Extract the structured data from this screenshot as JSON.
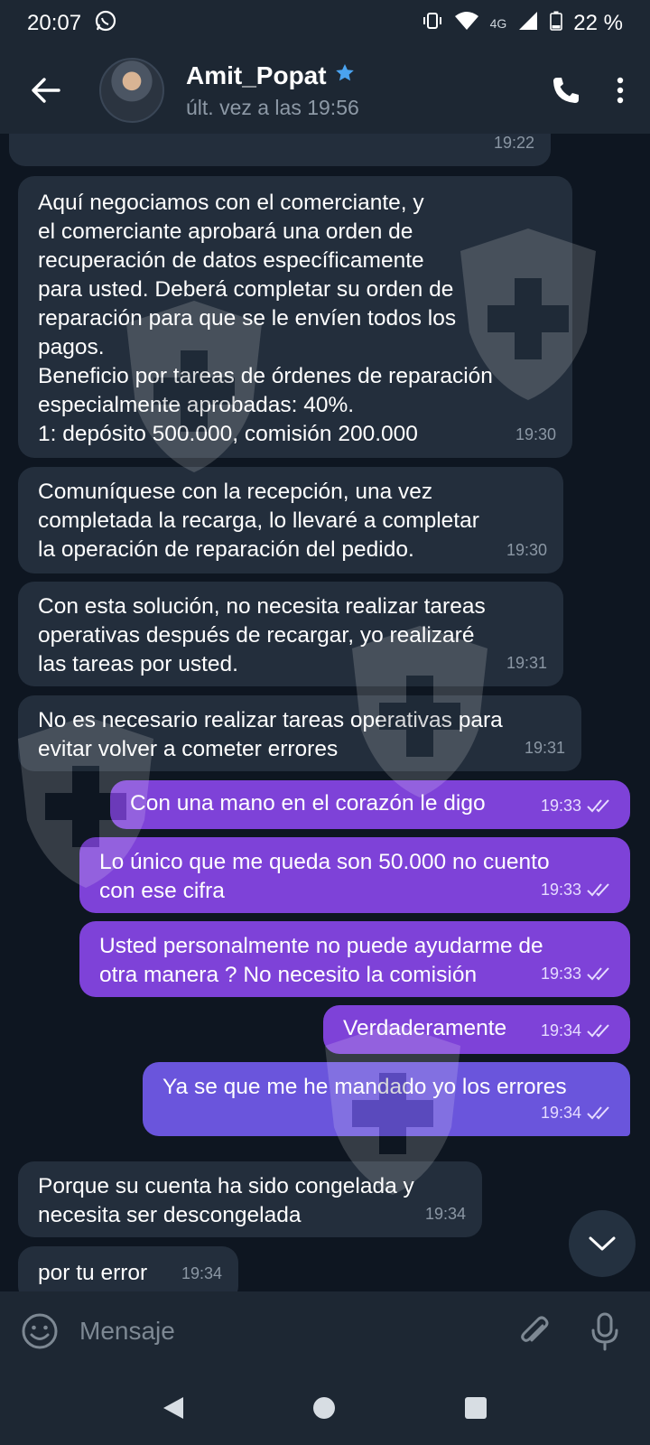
{
  "status_bar": {
    "time": "20:07",
    "network": "4G",
    "battery": "22 %"
  },
  "header": {
    "contact_name": "Amit_Popat",
    "last_seen": "últ. vez a las 19:56"
  },
  "messages": [
    {
      "direction": "in",
      "text": "",
      "time": "19:22"
    },
    {
      "direction": "in",
      "text": "Aquí negociamos con el comerciante, y\nel comerciante aprobará una orden de\nrecuperación de datos específicamente\npara usted. Deberá completar su orden de\nreparación para que se le envíen todos los\npagos.\nBeneficio por tareas de órdenes de reparación\nespecialmente aprobadas: 40%.\n1: depósito 500.000, comisión 200.000",
      "time": "19:30"
    },
    {
      "direction": "in",
      "text": "Comuníquese con la recepción, una vez\ncompletada la recarga, lo llevaré a completar\nla operación de reparación del pedido.",
      "time": "19:30"
    },
    {
      "direction": "in",
      "text": "Con esta solución, no necesita realizar tareas\noperativas después de recargar, yo realizaré\nlas tareas por usted.",
      "time": "19:31"
    },
    {
      "direction": "in",
      "text": "No es necesario realizar tareas operativas para\nevitar volver a cometer errores",
      "time": "19:31"
    },
    {
      "direction": "out",
      "text": "Con una mano en el corazón le digo",
      "time": "19:33"
    },
    {
      "direction": "out",
      "text": "Lo único que me queda son 50.000 no cuento\ncon ese cifra",
      "time": "19:33"
    },
    {
      "direction": "out",
      "text": "Usted personalmente no puede ayudarme de\notra manera ? No necesito la comisión",
      "time": "19:33"
    },
    {
      "direction": "out",
      "text": "Verdaderamente",
      "time": "19:34"
    },
    {
      "direction": "out",
      "text": "Ya se que me he mandado yo los errores",
      "time": "19:34"
    },
    {
      "direction": "in",
      "text": "Porque su cuenta ha sido congelada y\nnecesita ser descongelada",
      "time": "19:34"
    },
    {
      "direction": "in",
      "text": "por tu error",
      "time": "19:34"
    }
  ],
  "input": {
    "placeholder": "Mensaje"
  },
  "colors": {
    "incoming_bubble": "#232e3c",
    "outgoing_bubble": "#7e42d8",
    "background": "#0e1621",
    "bar": "#1d2733",
    "verified_star": "#4aa3f0"
  }
}
